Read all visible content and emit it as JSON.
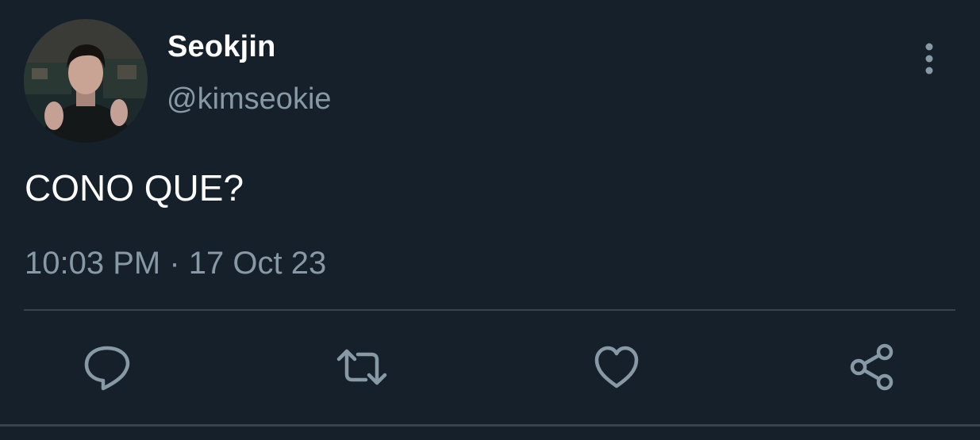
{
  "tweet": {
    "author": {
      "display_name": "Seokjin",
      "handle": "@kimseokie"
    },
    "text": "CONO QUE?",
    "timestamp": "10:03 PM · 17 Oct 23"
  },
  "icons": {
    "more": "vertical-dots-icon",
    "reply": "comment-bubble-icon",
    "retweet": "retweet-arrows-icon",
    "like": "heart-icon",
    "share": "share-nodes-icon"
  },
  "colors": {
    "background": "#15202b",
    "primary_text": "#ffffff",
    "secondary_text": "#8899a6",
    "divider": "#38444d"
  }
}
